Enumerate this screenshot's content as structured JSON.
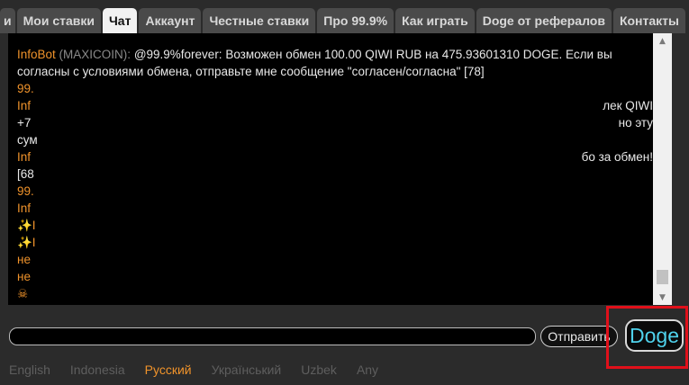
{
  "tabs": [
    {
      "label": "и",
      "active": false
    },
    {
      "label": "Мои ставки",
      "active": false
    },
    {
      "label": "Чат",
      "active": true
    },
    {
      "label": "Аккаунт",
      "active": false
    },
    {
      "label": "Честные ставки",
      "active": false
    },
    {
      "label": "Про 99.9%",
      "active": false
    },
    {
      "label": "Как играть",
      "active": false
    },
    {
      "label": "Doge от рефералов",
      "active": false
    },
    {
      "label": "Контакты",
      "active": false
    }
  ],
  "chat": {
    "messages": [
      {
        "name": "InfoBot",
        "tag": "(MAXICOIN):",
        "text": " @99.9%forever: Возможен обмен 100.00 QIWI RUB на 475.93601310 DOGE. Если вы",
        "right": ""
      },
      {
        "name": "",
        "tag": "",
        "text": "согласны с условиями обмена, отправьте мне сообщение \"согласен/согласна\" [78]",
        "right": ""
      },
      {
        "name": "99.",
        "tag": "",
        "text": "",
        "right": ""
      },
      {
        "name": "Inf",
        "tag": "",
        "text": "",
        "right": "лек QIWI"
      },
      {
        "name": "",
        "tag": "",
        "text": "+7",
        "right": "но эту"
      },
      {
        "name": "",
        "tag": "",
        "text": "сум",
        "right": ""
      },
      {
        "name": "Inf",
        "tag": "",
        "text": "",
        "right": "бо за обмен!"
      },
      {
        "name": "",
        "tag": "",
        "text": "[68",
        "right": ""
      },
      {
        "name": "99.",
        "tag": "",
        "text": "",
        "right": ""
      },
      {
        "name": "Inf",
        "tag": "",
        "text": "",
        "right": ""
      },
      {
        "name": "✨I",
        "tag": "",
        "text": "",
        "right": ""
      },
      {
        "name": "✨I",
        "tag": "",
        "text": "",
        "right": ""
      },
      {
        "name": "не",
        "tag": "",
        "text": "",
        "right": ""
      },
      {
        "name": "не",
        "tag": "",
        "text": "",
        "right": ""
      },
      {
        "name": "☠",
        "tag": "",
        "text": "",
        "right": ""
      }
    ]
  },
  "input": {
    "value": "",
    "placeholder": ""
  },
  "send_label": "Отправить",
  "doge_label": "Doge",
  "languages": [
    {
      "label": "English",
      "active": false
    },
    {
      "label": "Indonesia",
      "active": false
    },
    {
      "label": "Русский",
      "active": true
    },
    {
      "label": "Український",
      "active": false
    },
    {
      "label": "Uzbek",
      "active": false
    },
    {
      "label": "Any",
      "active": false
    }
  ],
  "colors": {
    "accent": "#f0932b",
    "doge": "#4fd2ec",
    "highlight": "#e0101a"
  }
}
